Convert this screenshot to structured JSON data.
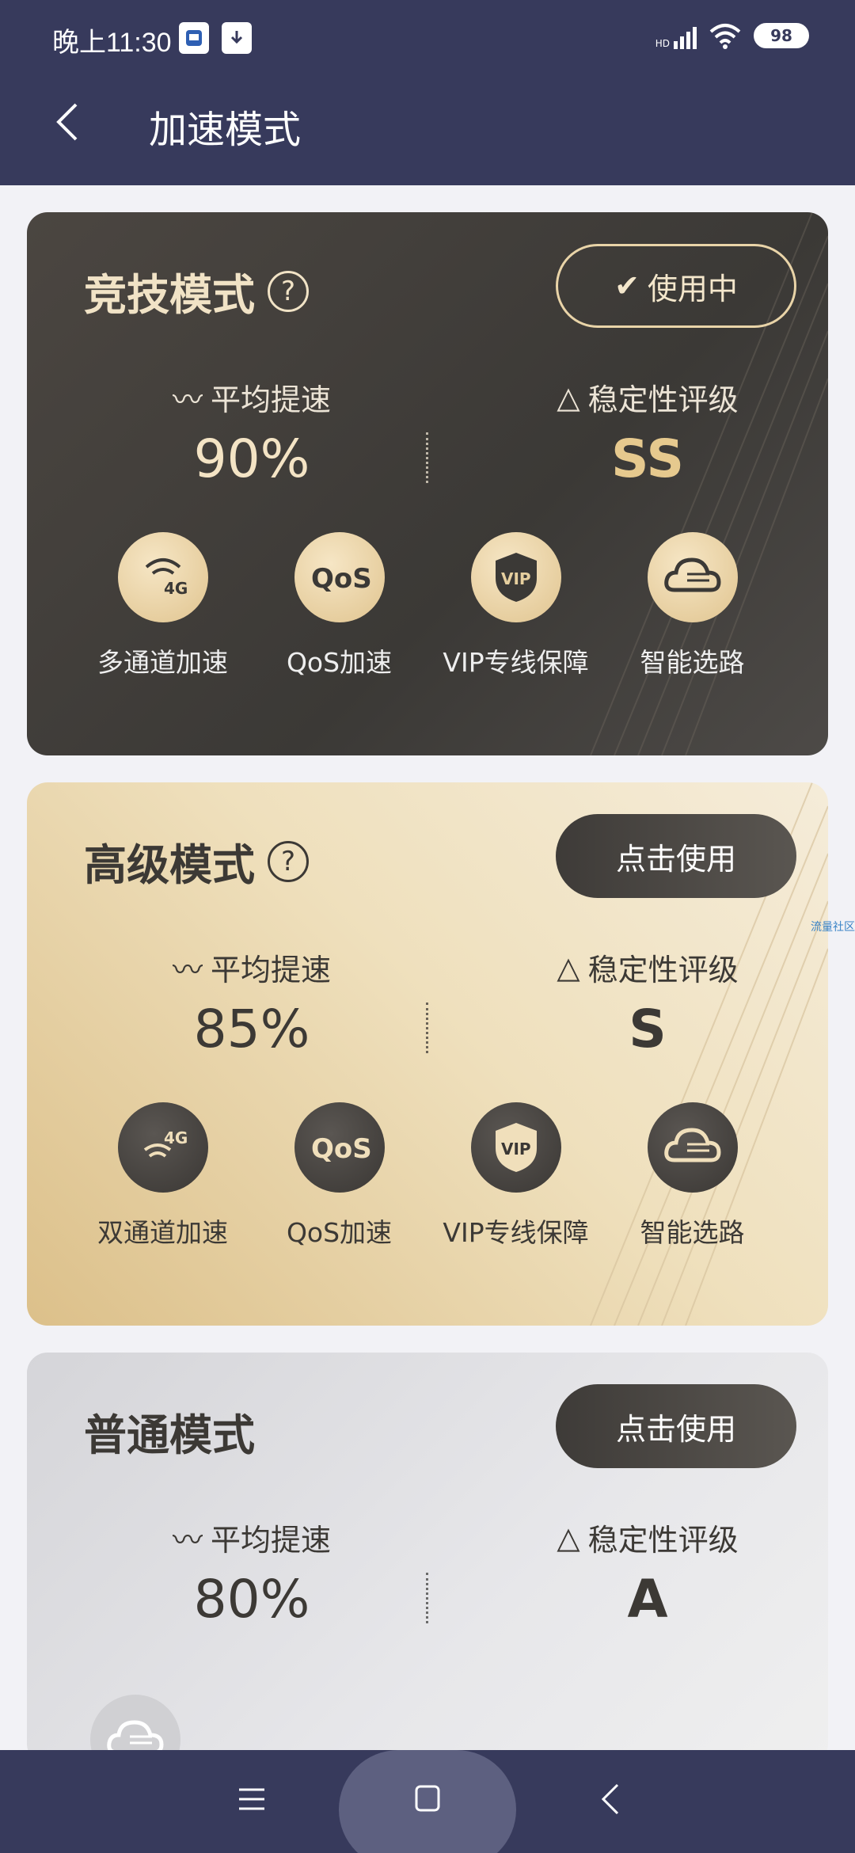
{
  "status_bar": {
    "time": "晚上11:30",
    "battery": "98",
    "network": "HD"
  },
  "header": {
    "title": "加速模式"
  },
  "modes": [
    {
      "title": "竞技模式",
      "button": "使用中",
      "speed_label": "平均提速",
      "speed_value": "90%",
      "stability_label": "稳定性评级",
      "stability_value": "SS",
      "features": [
        {
          "label": "多通道加速",
          "icon": "multichannel-4g-icon"
        },
        {
          "label": "QoS加速",
          "icon": "qos-icon"
        },
        {
          "label": "VIP专线保障",
          "icon": "vip-shield-icon"
        },
        {
          "label": "智能选路",
          "icon": "cloud-routing-icon"
        }
      ]
    },
    {
      "title": "高级模式",
      "button": "点击使用",
      "speed_label": "平均提速",
      "speed_value": "85%",
      "stability_label": "稳定性评级",
      "stability_value": "S",
      "features": [
        {
          "label": "双通道加速",
          "icon": "dualchannel-4g-icon"
        },
        {
          "label": "QoS加速",
          "icon": "qos-icon"
        },
        {
          "label": "VIP专线保障",
          "icon": "vip-shield-icon"
        },
        {
          "label": "智能选路",
          "icon": "cloud-routing-icon"
        }
      ]
    },
    {
      "title": "普通模式",
      "button": "点击使用",
      "speed_label": "平均提速",
      "speed_value": "80%",
      "stability_label": "稳定性评级",
      "stability_value": "A"
    }
  ],
  "watermark": "流量社区",
  "colors": {
    "header_bg": "#373a5c",
    "gold": "#e0c48f",
    "dark_card": "#3b3936"
  }
}
